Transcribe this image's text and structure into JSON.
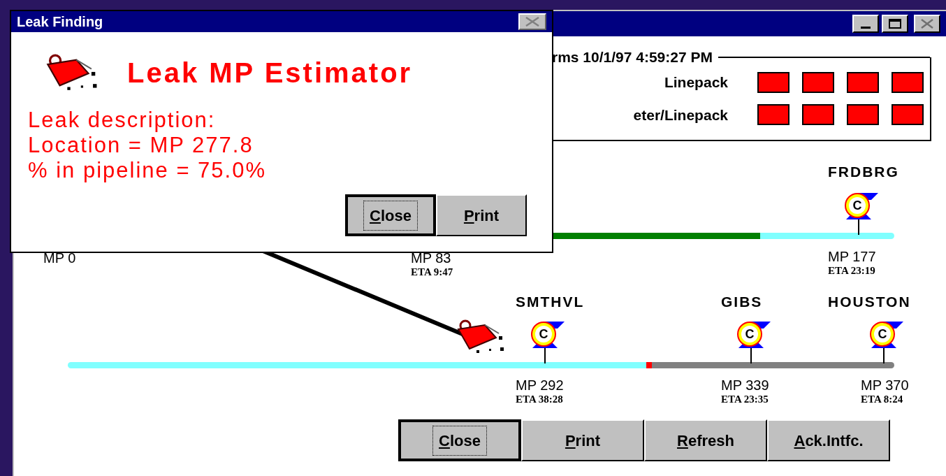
{
  "dialog": {
    "title": "Leak Finding",
    "close_disabled": true,
    "heading": "Leak MP Estimator",
    "lines": [
      "Leak description:",
      "Location = MP 277.8",
      "% in pipeline = 75.0%"
    ],
    "buttons": [
      {
        "label": "Close",
        "focused": true
      },
      {
        "label": "Print",
        "focused": false
      }
    ]
  },
  "main_window": {
    "alarms": {
      "title": "rms 10/1/97 4:59:27 PM",
      "rows": [
        {
          "label": "Linepack",
          "indicators": [
            {
              "color": "#ff0000"
            },
            {
              "color": "#ff0000"
            },
            {
              "color": "#ff0000"
            },
            {
              "color": "#ff0000"
            }
          ]
        },
        {
          "label": "eter/Linepack",
          "indicators": [
            {
              "color": "#ff0000"
            },
            {
              "color": "#ff0000"
            },
            {
              "color": "#ff0000"
            },
            {
              "color": "#ff0000"
            }
          ]
        }
      ]
    },
    "upper_line": {
      "segments": [
        {
          "color": "#007f00"
        },
        {
          "color": "#80ffff"
        }
      ],
      "markers": [
        {
          "mp": "MP 0"
        },
        {
          "mp": "MP 83",
          "eta": "ETA 9:47"
        }
      ],
      "stations": [
        {
          "name": "FRDBRG",
          "symbol": "C",
          "mp": "MP 177",
          "eta": "ETA 23:19"
        }
      ]
    },
    "lower_line": {
      "segments": [
        {
          "color": "#80ffff"
        },
        {
          "color": "#ff0000"
        },
        {
          "color": "#808080"
        }
      ],
      "leak_shown": true,
      "stations": [
        {
          "name": "SMTHVL",
          "symbol": "C",
          "mp": "MP 292",
          "eta": "ETA 38:28"
        },
        {
          "name": "GIBS",
          "symbol": "C",
          "mp": "MP 339",
          "eta": "ETA 23:35"
        },
        {
          "name": "HOUSTON",
          "symbol": "C",
          "mp": "MP 370",
          "eta": "ETA 8:24"
        }
      ]
    },
    "buttons": [
      {
        "label": "Close",
        "focused": true
      },
      {
        "label": "Print",
        "focused": false
      },
      {
        "label": "Refresh",
        "focused": false
      },
      {
        "label": "Ack.Intfc.",
        "focused": false
      }
    ]
  }
}
